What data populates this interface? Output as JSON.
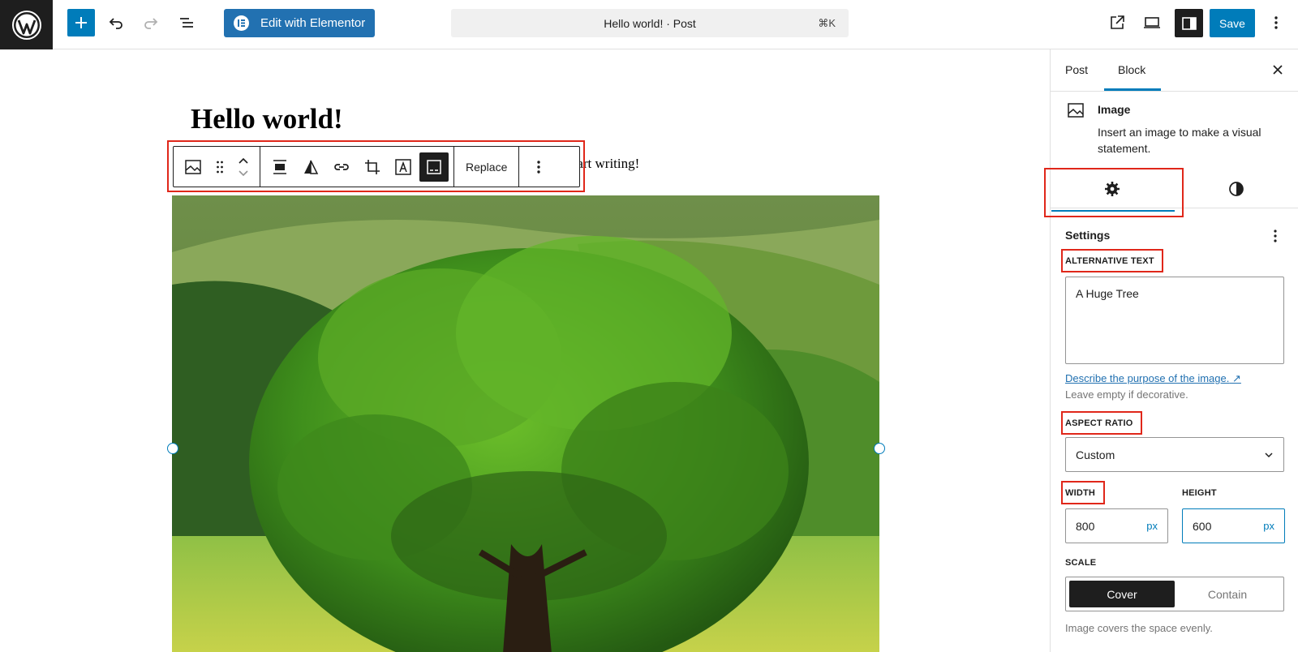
{
  "header": {
    "elementor_label": "Edit with Elementor",
    "command_bar": "Hello world! · Post",
    "command_shortcut": "⌘K",
    "save_label": "Save"
  },
  "editor": {
    "post_title": "Hello world!",
    "paragraph_partial": "start writing!",
    "toolbar": {
      "replace_label": "Replace"
    }
  },
  "sidebar": {
    "tabs": [
      {
        "label": "Post"
      },
      {
        "label": "Block"
      }
    ],
    "active_tab": "Block",
    "block_card": {
      "title": "Image",
      "description": "Insert an image to make a visual statement."
    },
    "settings": {
      "title": "Settings",
      "alt_text": {
        "label": "ALTERNATIVE TEXT",
        "value": "A Huge Tree",
        "help_link": "Describe the purpose of the image.",
        "help_text": "Leave empty if decorative."
      },
      "aspect_ratio": {
        "label": "ASPECT RATIO",
        "value": "Custom"
      },
      "width": {
        "label": "WIDTH",
        "value": "800",
        "unit": "px"
      },
      "height": {
        "label": "HEIGHT",
        "value": "600",
        "unit": "px"
      },
      "scale": {
        "label": "SCALE",
        "options": [
          "Cover",
          "Contain"
        ],
        "selected": "Cover",
        "help": "Image covers the space evenly."
      }
    }
  },
  "colors": {
    "accent": "#007cba",
    "highlight": "#e0271a",
    "dark": "#1e1e1e"
  }
}
